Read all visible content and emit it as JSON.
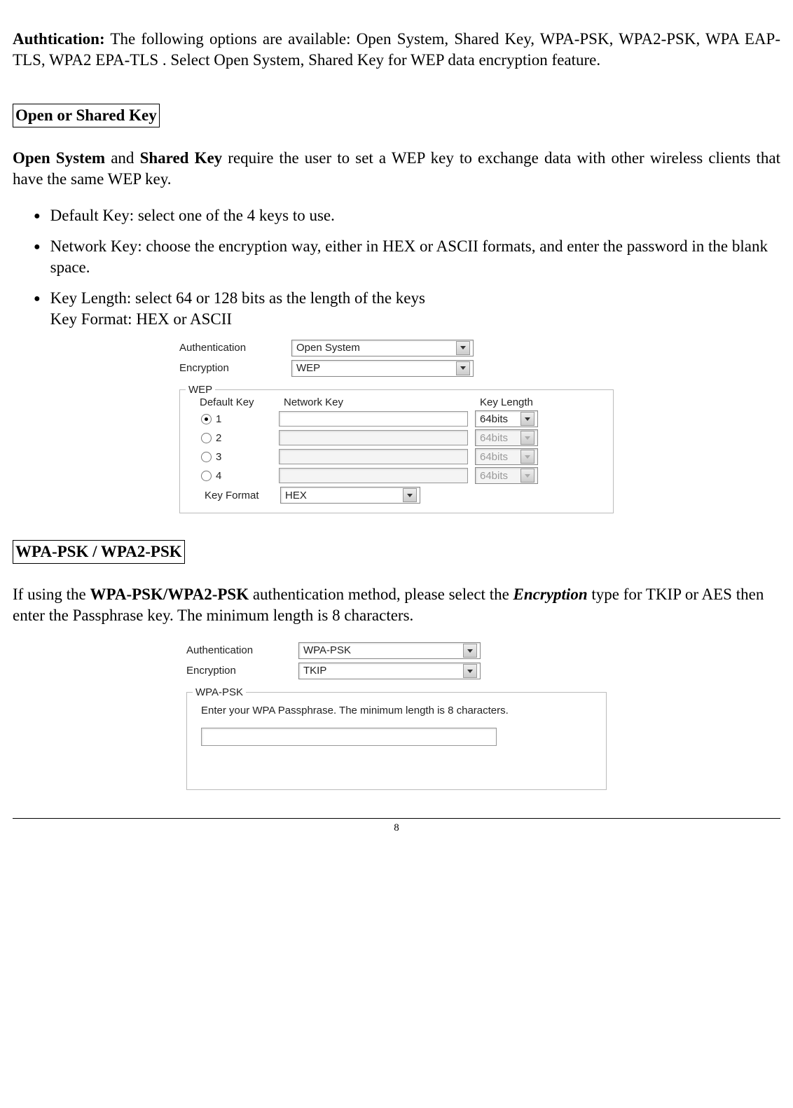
{
  "intro": {
    "label": "Authtication:",
    "text": " The following options are available: Open System, Shared Key, WPA-PSK, WPA2-PSK, WPA EAP-TLS, WPA2 EPA-TLS .  Select Open System, Shared Key for WEP data encryption feature."
  },
  "section1": {
    "title": "Open or Shared Key",
    "p_bold1": "Open System",
    "p_mid": " and ",
    "p_bold2": "Shared Key",
    "p_rest": " require the user to set a WEP key to exchange data with other wireless clients that have the same WEP key.",
    "bullets": [
      {
        "text": "Default Key: select one of the 4 keys to use."
      },
      {
        "text": "Network Key: choose the encryption way, either in HEX or ASCII formats, and enter the password in the blank space."
      },
      {
        "text": "Key Length: select 64 or 128 bits as the length of the keys",
        "sub": "Key Format: HEX or ASCII"
      }
    ]
  },
  "panel1": {
    "auth_label": "Authentication",
    "auth_value": "Open System",
    "enc_label": "Encryption",
    "enc_value": "WEP",
    "wep_legend": "WEP",
    "hdr_default": "Default Key",
    "hdr_network": "Network Key",
    "hdr_length": "Key Length",
    "keys": [
      {
        "num": "1",
        "len": "64bits",
        "checked": true,
        "enabled": true
      },
      {
        "num": "2",
        "len": "64bits",
        "checked": false,
        "enabled": false
      },
      {
        "num": "3",
        "len": "64bits",
        "checked": false,
        "enabled": false
      },
      {
        "num": "4",
        "len": "64bits",
        "checked": false,
        "enabled": false
      }
    ],
    "keyformat_label": "Key Format",
    "keyformat_value": "HEX"
  },
  "section2": {
    "title": "WPA-PSK / WPA2-PSK",
    "p_pre": "If using the ",
    "p_bold": "WPA-PSK/WPA2-PSK",
    "p_mid": " authentication method, please select the ",
    "p_italic": "Encryption",
    "p_rest": " type for TKIP or AES then enter the Passphrase key. The minimum length is 8 characters."
  },
  "panel2": {
    "auth_label": "Authentication",
    "auth_value": "WPA-PSK",
    "enc_label": "Encryption",
    "enc_value": "TKIP",
    "legend": "WPA-PSK",
    "instruction": "Enter your WPA Passphrase.  The minimum length is 8 characters."
  },
  "page_number": "8"
}
